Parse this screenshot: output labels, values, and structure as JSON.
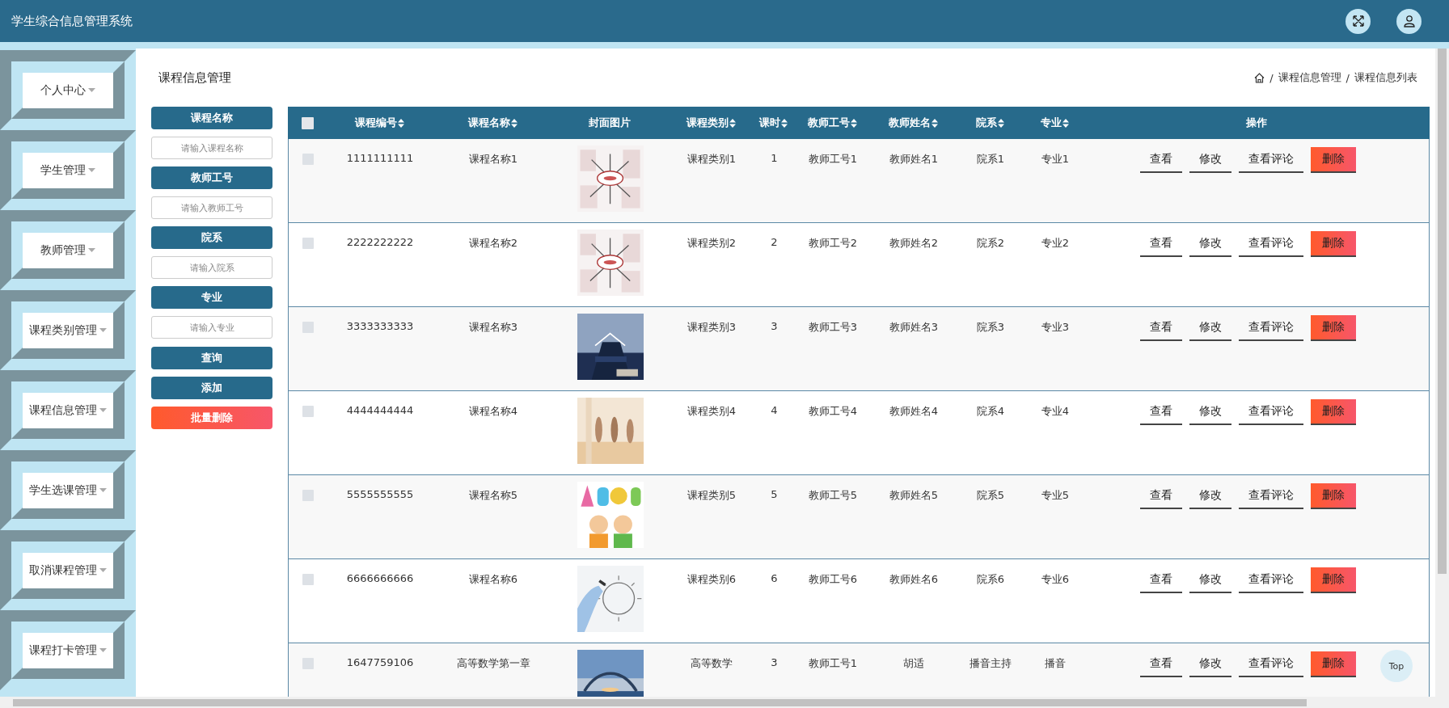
{
  "header": {
    "title": "学生综合信息管理系统"
  },
  "sidebar": {
    "items": [
      {
        "label": "个人中心"
      },
      {
        "label": "学生管理"
      },
      {
        "label": "教师管理"
      },
      {
        "label": "课程类别管理"
      },
      {
        "label": "课程信息管理"
      },
      {
        "label": "学生选课管理"
      },
      {
        "label": "取消课程管理"
      },
      {
        "label": "课程打卡管理"
      }
    ]
  },
  "page": {
    "title": "课程信息管理",
    "breadcrumb": {
      "separator": "/",
      "items": [
        "课程信息管理",
        "课程信息列表"
      ]
    }
  },
  "filters": [
    {
      "kind": "label",
      "text": "课程名称"
    },
    {
      "kind": "input",
      "placeholder": "请输入课程名称"
    },
    {
      "kind": "label",
      "text": "教师工号"
    },
    {
      "kind": "input",
      "placeholder": "请输入教师工号"
    },
    {
      "kind": "label",
      "text": "院系"
    },
    {
      "kind": "input",
      "placeholder": "请输入院系"
    },
    {
      "kind": "label",
      "text": "专业"
    },
    {
      "kind": "input",
      "placeholder": "请输入专业"
    },
    {
      "kind": "primary",
      "text": "查询"
    },
    {
      "kind": "primary",
      "text": "添加"
    },
    {
      "kind": "danger",
      "text": "批量删除"
    }
  ],
  "table": {
    "header_checkbox": {
      "checked": false
    },
    "columns": [
      {
        "label": "课程编号",
        "sortable": true
      },
      {
        "label": "课程名称",
        "sortable": true
      },
      {
        "label": "封面图片",
        "sortable": false
      },
      {
        "label": "课程类别",
        "sortable": true
      },
      {
        "label": "课时",
        "sortable": true
      },
      {
        "label": "教师工号",
        "sortable": true
      },
      {
        "label": "教师姓名",
        "sortable": true
      },
      {
        "label": "院系",
        "sortable": true
      },
      {
        "label": "专业",
        "sortable": true
      },
      {
        "label": "操作",
        "sortable": false
      }
    ],
    "rows": [
      {
        "checked": false,
        "cells": [
          "1111111111",
          "课程名称1",
          {
            "kind": "picture"
          },
          "课程类别1",
          "1",
          "教师工号1",
          "教师姓名1",
          "院系1",
          "专业1"
        ],
        "actions": [
          {
            "kind": "plain",
            "label": "查看"
          },
          {
            "kind": "plain",
            "label": "修改"
          },
          {
            "kind": "plain",
            "label": "查看评论"
          },
          {
            "kind": "danger",
            "label": "删除"
          }
        ]
      },
      {
        "checked": false,
        "cells": [
          "2222222222",
          "课程名称2",
          {
            "kind": "picture"
          },
          "课程类别2",
          "2",
          "教师工号2",
          "教师姓名2",
          "院系2",
          "专业2"
        ],
        "actions": [
          {
            "kind": "plain",
            "label": "查看"
          },
          {
            "kind": "plain",
            "label": "修改"
          },
          {
            "kind": "plain",
            "label": "查看评论"
          },
          {
            "kind": "danger",
            "label": "删除"
          }
        ]
      },
      {
        "checked": false,
        "cells": [
          "3333333333",
          "课程名称3",
          {
            "kind": "picture"
          },
          "课程类别3",
          "3",
          "教师工号3",
          "教师姓名3",
          "院系3",
          "专业3"
        ],
        "actions": [
          {
            "kind": "plain",
            "label": "查看"
          },
          {
            "kind": "plain",
            "label": "修改"
          },
          {
            "kind": "plain",
            "label": "查看评论"
          },
          {
            "kind": "danger",
            "label": "删除"
          }
        ]
      },
      {
        "checked": false,
        "cells": [
          "4444444444",
          "课程名称4",
          {
            "kind": "picture"
          },
          "课程类别4",
          "4",
          "教师工号4",
          "教师姓名4",
          "院系4",
          "专业4"
        ],
        "actions": [
          {
            "kind": "plain",
            "label": "查看"
          },
          {
            "kind": "plain",
            "label": "修改"
          },
          {
            "kind": "plain",
            "label": "查看评论"
          },
          {
            "kind": "danger",
            "label": "删除"
          }
        ]
      },
      {
        "checked": false,
        "cells": [
          "5555555555",
          "课程名称5",
          {
            "kind": "picture"
          },
          "课程类别5",
          "5",
          "教师工号5",
          "教师姓名5",
          "院系5",
          "专业5"
        ],
        "actions": [
          {
            "kind": "plain",
            "label": "查看"
          },
          {
            "kind": "plain",
            "label": "修改"
          },
          {
            "kind": "plain",
            "label": "查看评论"
          },
          {
            "kind": "danger",
            "label": "删除"
          }
        ]
      },
      {
        "checked": false,
        "cells": [
          "6666666666",
          "课程名称6",
          {
            "kind": "picture"
          },
          "课程类别6",
          "6",
          "教师工号6",
          "教师姓名6",
          "院系6",
          "专业6"
        ],
        "actions": [
          {
            "kind": "plain",
            "label": "查看"
          },
          {
            "kind": "plain",
            "label": "修改"
          },
          {
            "kind": "plain",
            "label": "查看评论"
          },
          {
            "kind": "danger",
            "label": "删除"
          }
        ]
      },
      {
        "checked": false,
        "cells": [
          "1647759106",
          "高等数学第一章",
          {
            "kind": "picture"
          },
          "高等数学",
          "3",
          "教师工号1",
          "胡适",
          "播音主持",
          "播音"
        ],
        "actions": [
          {
            "kind": "plain",
            "label": "查看"
          },
          {
            "kind": "plain",
            "label": "修改"
          },
          {
            "kind": "plain",
            "label": "查看评论"
          },
          {
            "kind": "danger",
            "label": "删除"
          }
        ]
      }
    ]
  },
  "top_button": {
    "label": "Top"
  }
}
